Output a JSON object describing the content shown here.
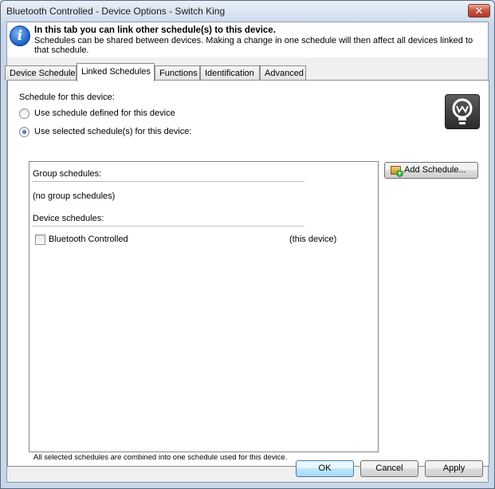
{
  "window": {
    "title": "Bluetooth Controlled - Device Options - Switch King",
    "close_glyph": "✕"
  },
  "header": {
    "icon": "info-icon",
    "icon_glyph": "i",
    "title": "In this tab you can link other schedule(s) to this device.",
    "description": "Schedules can be shared between devices. Making a change in one schedule will then affect all devices linked to that schedule."
  },
  "tabs": [
    {
      "label": "Device Schedule",
      "active": false
    },
    {
      "label": "Linked Schedules",
      "active": true
    },
    {
      "label": "Functions",
      "active": false
    },
    {
      "label": "Identification",
      "active": false
    },
    {
      "label": "Advanced",
      "active": false
    }
  ],
  "linked": {
    "section_label": "Schedule for this device:",
    "radio_options": [
      {
        "label": "Use schedule defined for this device",
        "selected": false
      },
      {
        "label": "Use selected schedule(s) for this device:",
        "selected": true
      }
    ],
    "device_icon": "lightbulb-icon",
    "group_schedules_header": "Group schedules:",
    "group_schedules_empty": "(no group schedules)",
    "device_schedules_header": "Device schedules:",
    "device_schedules": [
      {
        "name": "Bluetooth Controlled",
        "note": "(this device)",
        "checked": false
      }
    ],
    "add_schedule_label": "Add Schedule...",
    "footer_note": "All selected schedules are combined into one schedule used for this device."
  },
  "buttons": {
    "ok": "OK",
    "cancel": "Cancel",
    "apply": "Apply"
  }
}
